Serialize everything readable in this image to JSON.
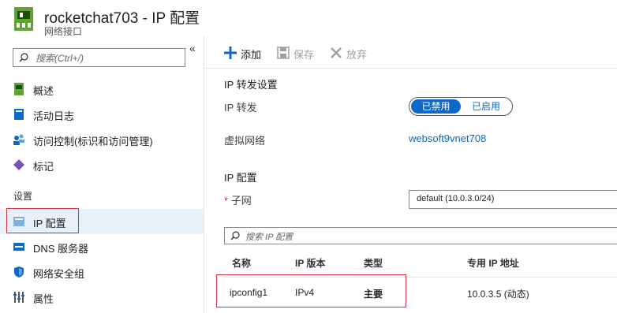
{
  "header": {
    "title": "rocketchat703 - IP 配置",
    "subtitle": "网络接口",
    "icon": "network-interface-icon"
  },
  "sidebar": {
    "collapse_glyph": "«",
    "search_placeholder": "搜索(Ctrl+/)",
    "items": [
      {
        "label": "概述",
        "icon": "overview-icon"
      },
      {
        "label": "活动日志",
        "icon": "activity-log-icon"
      },
      {
        "label": "访问控制(标识和访问管理)",
        "icon": "access-control-icon"
      },
      {
        "label": "标记",
        "icon": "tag-icon"
      }
    ],
    "section_settings": "设置",
    "settings_items": [
      {
        "label": "IP 配置",
        "icon": "ip-config-icon",
        "selected": true
      },
      {
        "label": "DNS 服务器",
        "icon": "dns-icon"
      },
      {
        "label": "网络安全组",
        "icon": "security-group-icon"
      },
      {
        "label": "属性",
        "icon": "properties-icon"
      }
    ]
  },
  "toolbar": {
    "add": "添加",
    "save": "保存",
    "discard": "放弃"
  },
  "forwarding": {
    "section_title": "IP 转发设置",
    "label": "IP 转发",
    "disabled": "已禁用",
    "enabled": "已启用",
    "selected": "已禁用"
  },
  "vnet": {
    "label": "虚拟网络",
    "value": "websoft9vnet708"
  },
  "ipconfig": {
    "section_title": "IP 配置",
    "required_mark": "*",
    "subnet_label": "子网",
    "subnet_value": "default (10.0.3.0/24)",
    "filter_placeholder": "搜索 IP 配置"
  },
  "table": {
    "headers": [
      "名称",
      "IP 版本",
      "类型",
      "专用 IP 地址"
    ],
    "rows": [
      {
        "name": "ipconfig1",
        "version": "IPv4",
        "type": "主要",
        "private_ip": "10.0.3.5 (动态)"
      }
    ]
  },
  "colors": {
    "accent": "#0b6ac9",
    "highlight_outline": "#d13438",
    "selected_bg": "#e8f1fa"
  }
}
